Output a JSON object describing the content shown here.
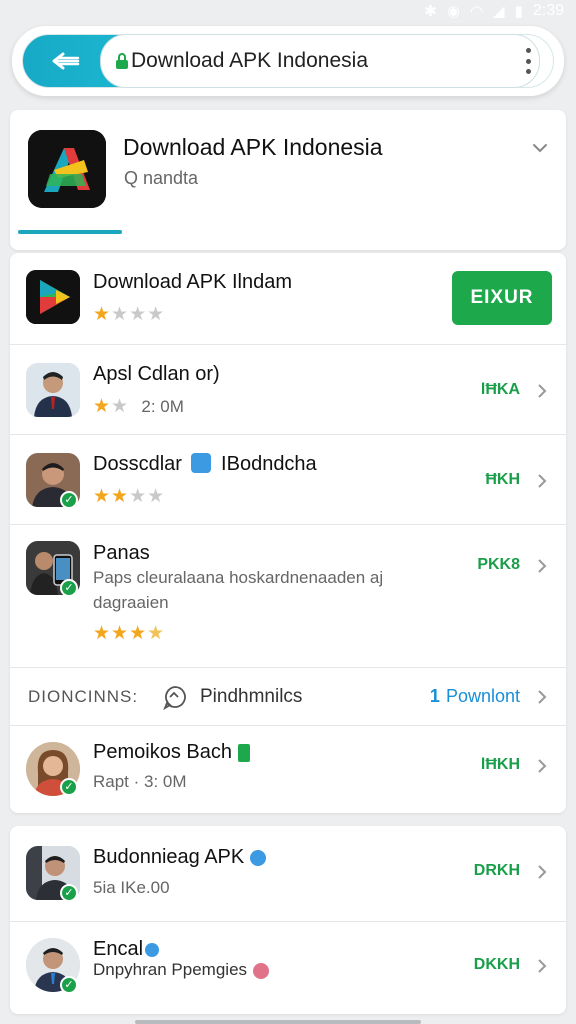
{
  "status_bar": {
    "time": "2:39"
  },
  "address_bar": {
    "url": "Download APK Indonesia"
  },
  "header": {
    "title": "Download APK Indonesia",
    "subtitle": "Q nandta"
  },
  "featured": {
    "title": "Download APK Ilndam",
    "rating_on": "★",
    "rating_off": "★★★",
    "install_label": "EIXUR"
  },
  "rows": [
    {
      "title": "Apsl Cdlan or)",
      "sub": "2: 0M",
      "stars_on": "★",
      "stars_off": "★",
      "size": "lĦKA"
    },
    {
      "title": "Dosscdlar",
      "title2": "IBodndcha",
      "stars_on": "★★",
      "stars_off": "★★",
      "size": "ĦKH"
    },
    {
      "title": "Panas",
      "sub": "Paps cleuralaana hoskardnenaaden aj",
      "sub2": "dagraaien",
      "stars_on": "★★★",
      "stars_off": "★",
      "size": "PKK8"
    }
  ],
  "section": {
    "label": "DIONCINNS:",
    "mid": "Pindhmnilcs",
    "right": "Pownlont",
    "right_icon": "1"
  },
  "row_last": {
    "title": "Pemoikos Bach",
    "sub": "Rapt · 3: 0M",
    "size": "lĦKH"
  },
  "card2_rows": [
    {
      "title": "Budonnieag APK",
      "sub": "5ia IKe.00",
      "size": "DRKH"
    },
    {
      "title": "Encal",
      "sub": "Dnpyhran Ppemgies",
      "size": "DKKH"
    }
  ],
  "colors": {
    "accent": "#1aa6bd",
    "install": "#1ea84c",
    "link": "#1a8fd8",
    "star": "#f2a61d"
  }
}
